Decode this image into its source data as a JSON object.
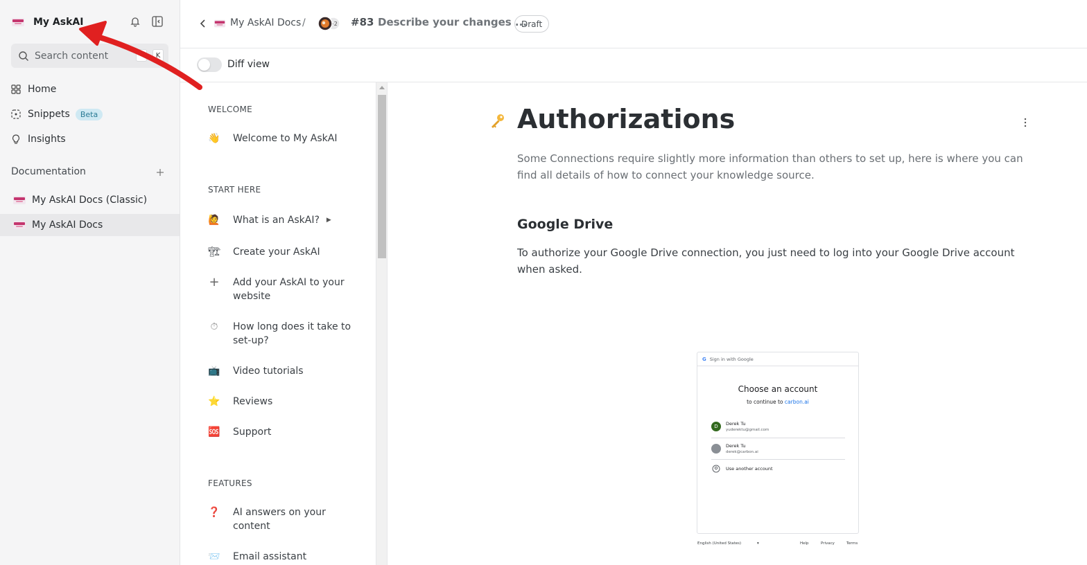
{
  "sidebar": {
    "org_title": "My AskAI",
    "search_placeholder": "Search content",
    "shortcut_key1": "^",
    "shortcut_key2": "K",
    "nav": {
      "home": "Home",
      "snippets": "Snippets",
      "snippets_badge": "Beta",
      "insights": "Insights"
    },
    "documentation_label": "Documentation",
    "spaces": [
      "My AskAI Docs (Classic)",
      "My AskAI Docs"
    ]
  },
  "topbar": {
    "breadcrumb_space": "My AskAI Docs",
    "breadcrumb_sep": "/",
    "change_request_number": "#83",
    "change_request_title": "Describe your changes ...",
    "status_badge": "Draft"
  },
  "diffbar": {
    "label": "Diff view",
    "enabled": false
  },
  "toc": {
    "sections": [
      "WELCOME",
      "START HERE",
      "FEATURES"
    ],
    "items": [
      {
        "emoji": "👋",
        "label": "Welcome to My AskAI"
      },
      {
        "emoji": "🙋",
        "label": "What is an AskAI?"
      },
      {
        "emoji": "🏗",
        "label": "Create your AskAI"
      },
      {
        "emoji": "+",
        "label": "Add your AskAI to your website"
      },
      {
        "emoji": "⏱",
        "label": "How long does it take to set-up?"
      },
      {
        "emoji": "📺",
        "label": "Video tutorials"
      },
      {
        "emoji": "⭐",
        "label": "Reviews"
      },
      {
        "emoji": "🆘",
        "label": "Support"
      },
      {
        "emoji": "❓",
        "label": "AI answers on your content"
      },
      {
        "emoji": "📨",
        "label": "Email assistant"
      }
    ]
  },
  "page": {
    "title": "Authorizations",
    "description": "Some Connections require slightly more information than others to set up, here is where you can find all details of how to connect your knowledge source.",
    "section_heading": "Google Drive",
    "section_text": "To authorize your Google Drive connection, you just need to log into your Google Drive account when asked."
  },
  "embedded_image": {
    "header": "Sign in with Google",
    "heading": "Choose an account",
    "subtext": "to continue to",
    "subtext_link": "carbon.ai",
    "accounts": [
      {
        "initial": "D",
        "name": "Derek Tu",
        "email": "yuderektu@gmail.com"
      },
      {
        "initial": "",
        "name": "Derek Tu",
        "email": "derek@carbon.ai"
      }
    ],
    "another": "Use another account",
    "footer_lang": "English (United States)",
    "footer_help": "Help",
    "footer_privacy": "Privacy",
    "footer_terms": "Terms"
  },
  "colors": {
    "annotation_arrow": "#e02020",
    "sidebar_bg": "#f5f5f6",
    "beta_badge_bg": "#cfe9f3",
    "beta_badge_text": "#2a7b95"
  }
}
